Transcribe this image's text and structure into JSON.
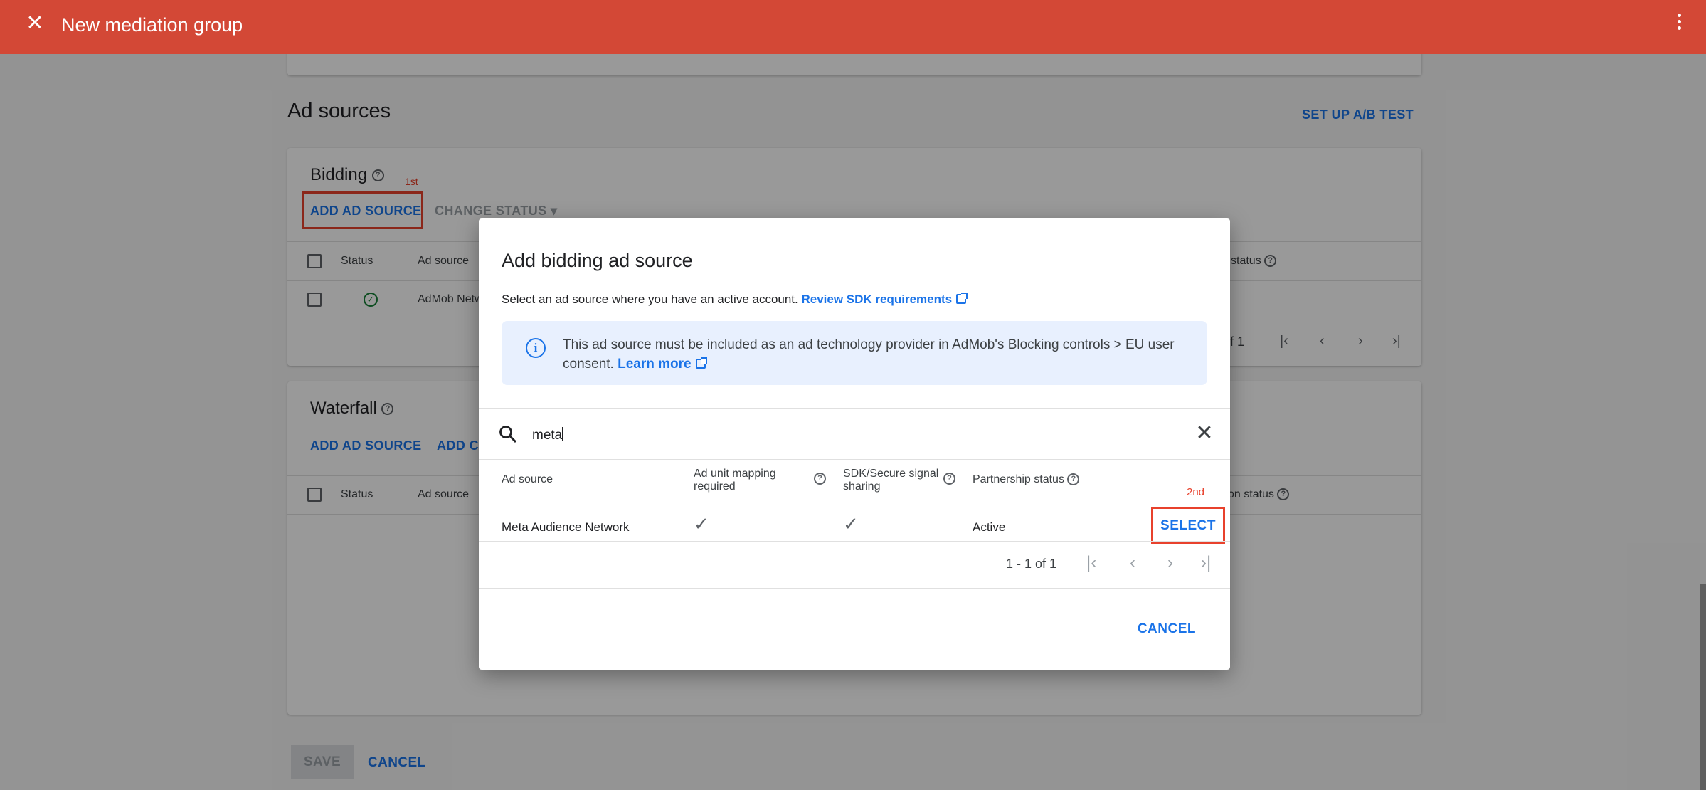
{
  "topbar": {
    "title": "New mediation group",
    "close_icon": "close-icon",
    "menu_icon": "more-vert-icon"
  },
  "colors": {
    "topbar": "#d34836",
    "link": "#1a73e8",
    "highlight": "#e8412c"
  },
  "ad_sources": {
    "heading": "Ad sources",
    "ab_test_label": "SET UP A/B TEST",
    "bidding": {
      "title": "Bidding",
      "add_label": "ADD AD SOURCE",
      "change_status_label": "CHANGE STATUS",
      "annotation": "1st",
      "columns": [
        "Status",
        "Ad source",
        "status"
      ],
      "rows": [
        {
          "ad_source": "AdMob Netw"
        }
      ],
      "pager_text": "f 1"
    },
    "waterfall": {
      "title": "Waterfall",
      "add_label": "ADD AD SOURCE",
      "add_custom_label": "ADD CU",
      "columns": [
        "Status",
        "Ad source",
        "on status"
      ]
    }
  },
  "footer": {
    "save_label": "SAVE",
    "cancel_label": "CANCEL"
  },
  "dialog": {
    "title": "Add bidding ad source",
    "subtitle": "Select an ad source where you have an active account.",
    "sdk_link": "Review SDK requirements",
    "info_text": "This ad source must be included as an ad technology provider in AdMob's Blocking controls > EU user consent.",
    "info_link": "Learn more",
    "search_value": "meta",
    "columns": {
      "ad_source": "Ad source",
      "mapping": "Ad unit mapping required",
      "sdk": "SDK/Secure signal sharing",
      "partnership": "Partnership status"
    },
    "row": {
      "ad_source": "Meta Audience Network",
      "mapping_check": "✓",
      "sdk_check": "✓",
      "partnership": "Active",
      "select_label": "SELECT",
      "annotation": "2nd"
    },
    "pager_text": "1 - 1 of 1",
    "cancel_label": "CANCEL"
  }
}
